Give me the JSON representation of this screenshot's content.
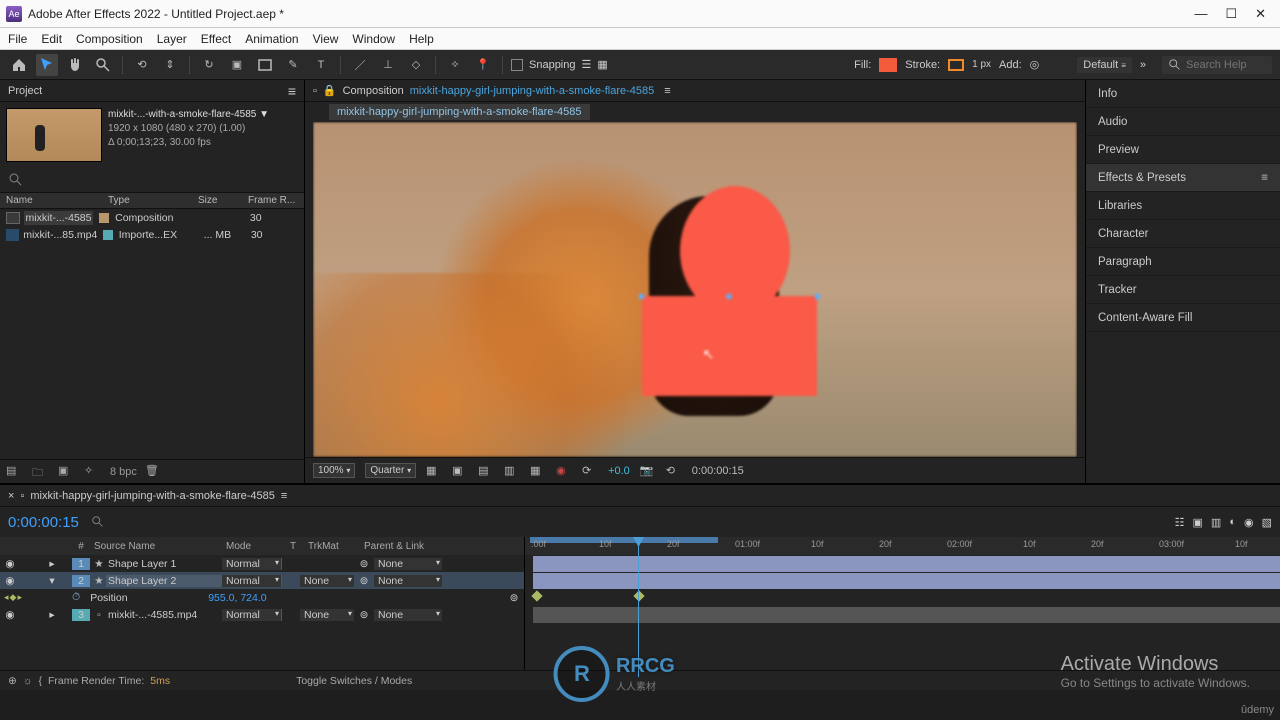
{
  "title_bar": {
    "app": "Adobe After Effects 2022",
    "project": "Untitled Project.aep *"
  },
  "menu": [
    "File",
    "Edit",
    "Composition",
    "Layer",
    "Effect",
    "Animation",
    "View",
    "Window",
    "Help"
  ],
  "toolbar": {
    "snapping": "Snapping",
    "fill_label": "Fill:",
    "fill_color": "#f45a3c",
    "stroke_label": "Stroke:",
    "stroke_color": "#f08a2a",
    "stroke_px": "1 px",
    "add_label": "Add:",
    "workspace": "Default",
    "search_ph": "Search Help"
  },
  "project_panel": {
    "title": "Project",
    "selected": {
      "name": "mixkit-...-with-a-smoke-flare-4585",
      "dims": "1920 x 1080  (480 x 270) (1.00)",
      "dur": "Δ 0;00;13;23, 30.00 fps"
    },
    "cols": {
      "name": "Name",
      "label": " ",
      "type": "Type",
      "size": "Size",
      "fr": "Frame R..."
    },
    "rows": [
      {
        "name": "mixkit-...-4585",
        "type": "Composition",
        "size": "",
        "fr": "30",
        "label_color": "#b8986a"
      },
      {
        "name": "mixkit-...85.mp4",
        "type": "Importe...EX",
        "size": "... MB",
        "fr": "30",
        "label_color": "#55aab4"
      }
    ],
    "bpc": "8 bpc"
  },
  "comp_panel": {
    "crumb_label": "Composition",
    "crumb_name": "mixkit-happy-girl-jumping-with-a-smoke-flare-4585",
    "tab": "mixkit-happy-girl-jumping-with-a-smoke-flare-4585",
    "zoom": "100%",
    "res": "Quarter",
    "exposure": "+0.0",
    "time": "0:00:00:15"
  },
  "right_panel": {
    "items": [
      "Info",
      "Audio",
      "Preview",
      "Effects & Presets",
      "Libraries",
      "Character",
      "Paragraph",
      "Tracker",
      "Content-Aware Fill"
    ],
    "selected": "Effects & Presets"
  },
  "timeline": {
    "tab": "mixkit-happy-girl-jumping-with-a-smoke-flare-4585",
    "cti": "0:00:00:15",
    "cols": {
      "num": "#",
      "name": "Source Name",
      "mode": "Mode",
      "t": "T",
      "trk": "TrkMat",
      "parent": "Parent & Link"
    },
    "layers": [
      {
        "num": "1",
        "name": "Shape Layer 1",
        "mode": "Normal",
        "trk": "",
        "parent": "None",
        "color": "#5a8ab8",
        "icon": "star"
      },
      {
        "num": "2",
        "name": "Shape Layer 2",
        "mode": "Normal",
        "trk": "None",
        "parent": "None",
        "color": "#5a8ab8",
        "icon": "star",
        "selected": true
      },
      {
        "num": "3",
        "name": "mixkit-...-4585.mp4",
        "mode": "Normal",
        "trk": "None",
        "parent": "None",
        "color": "#55aab4",
        "icon": "mov"
      }
    ],
    "prop": {
      "name": "Position",
      "value": "955.0, 724.0"
    },
    "ruler": [
      ":00f",
      "10f",
      "20f",
      "01:00f",
      "10f",
      "20f",
      "02:00f",
      "10f",
      "20f",
      "03:00f",
      "10f"
    ],
    "footer": {
      "label": "Frame Render Time:",
      "value": "5ms",
      "toggle": "Toggle Switches / Modes"
    }
  },
  "overlay": {
    "activate_h": "Activate Windows",
    "activate_s": "Go to Settings to activate Windows.",
    "udemy": "ûdemy",
    "rrcg": "RRCG",
    "rrcg_sub": "人人素材"
  }
}
